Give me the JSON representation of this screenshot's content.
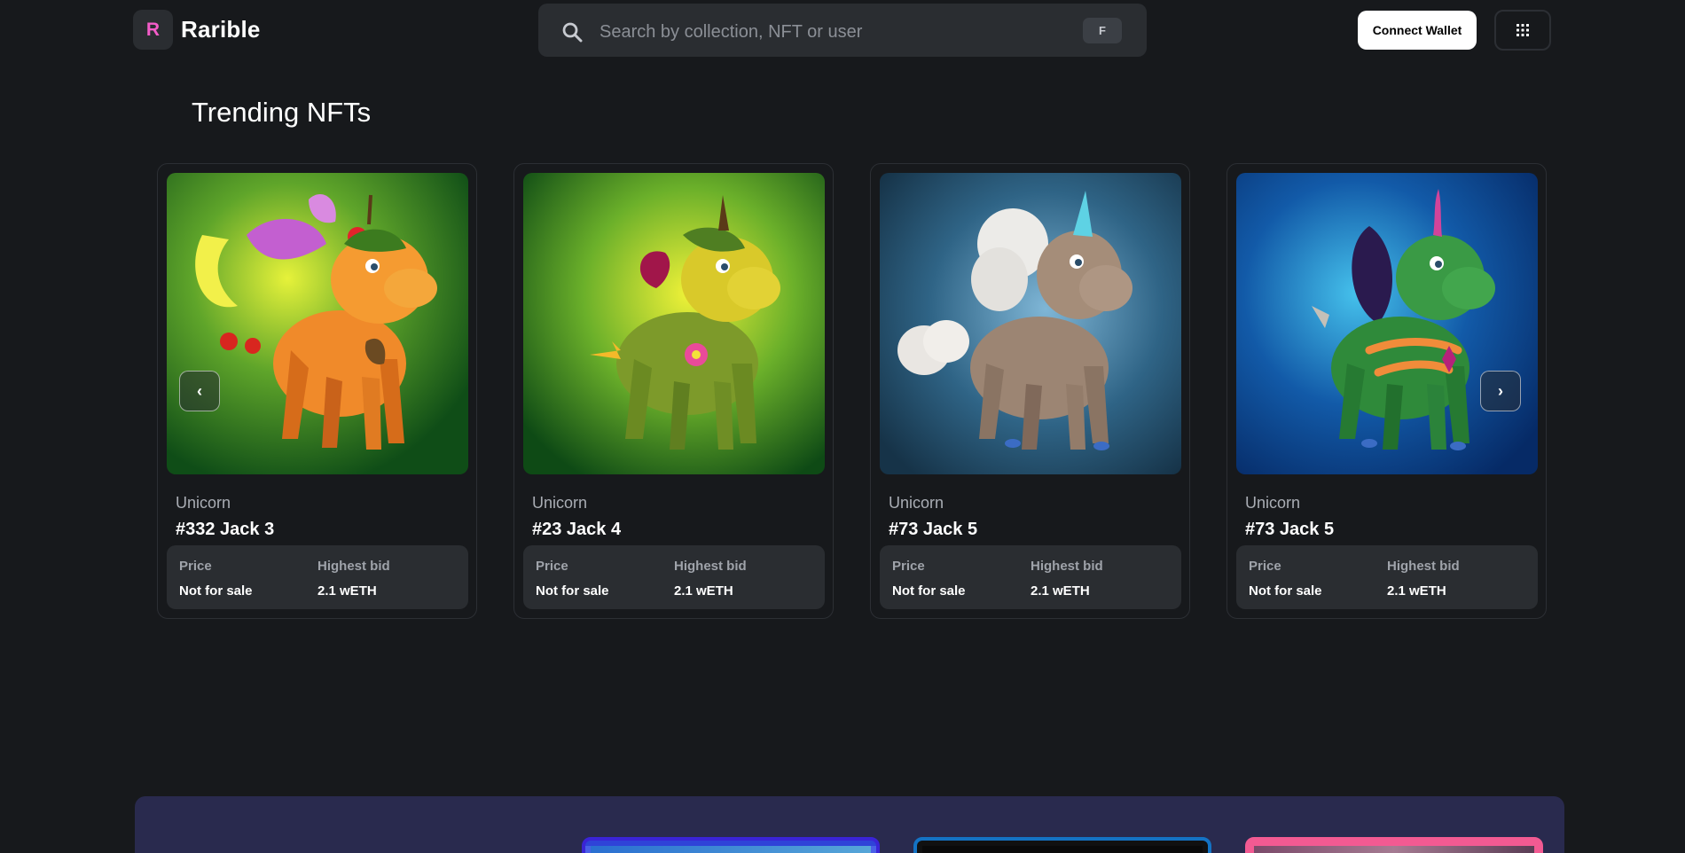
{
  "header": {
    "logo_mark": "R",
    "logo_text": "Rarible",
    "search_placeholder": "Search by collection, NFT or user",
    "search_shortcut": "F",
    "connect_label": "Connect Wallet",
    "menu_icon": "grid-menu-icon"
  },
  "section": {
    "title": "Trending NFTs"
  },
  "cards": [
    {
      "collection": "Unicorn",
      "name": "#332 Jack 3",
      "price_label": "Price",
      "price_value": "Not for sale",
      "bid_label": "Highest bid",
      "bid_value": "2.1 wETH"
    },
    {
      "collection": "Unicorn",
      "name": "#23 Jack 4",
      "price_label": "Price",
      "price_value": "Not for sale",
      "bid_label": "Highest bid",
      "bid_value": "2.1 wETH"
    },
    {
      "collection": "Unicorn",
      "name": "#73 Jack 5",
      "price_label": "Price",
      "price_value": "Not for sale",
      "bid_label": "Highest bid",
      "bid_value": "2.1 wETH"
    },
    {
      "collection": "Unicorn",
      "name": "#73 Jack 5",
      "price_label": "Price",
      "price_value": "Not for sale",
      "bid_label": "Highest bid",
      "bid_value": "2.1 wETH"
    }
  ],
  "carousel": {
    "prev_glyph": "‹",
    "next_glyph": "›"
  },
  "colors": {
    "background": "#17191c",
    "surface": "#2a2d31",
    "brand": "#f35cc8",
    "banner": "#292a4e"
  }
}
